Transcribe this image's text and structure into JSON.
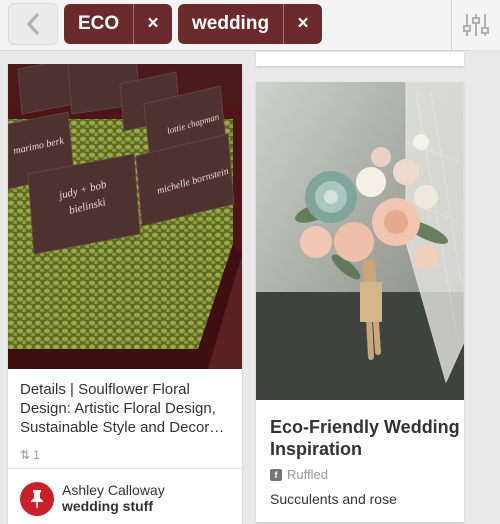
{
  "search": {
    "tokens": [
      {
        "label": "ECO",
        "remove": "×"
      },
      {
        "label": "wedding",
        "remove": "×"
      }
    ]
  },
  "pins": [
    {
      "description": "Details | Soulflower Floral Design: Artistic Floral Design, Sustainable Style and Decor…",
      "repin_count": "1",
      "pinner": "Ashley Calloway",
      "board": "wedding stuff",
      "place_cards": [
        "marimo berk",
        "judy + bob bielinski",
        "michelle bornstein",
        "lottie chapman"
      ]
    },
    {
      "title": "Eco-Friendly Wedding Inspiration",
      "source": "Ruffled",
      "caption": "Succulents and rose"
    }
  ],
  "colors": {
    "accent": "#6b2a2c",
    "pinterest_red": "#cb2027"
  }
}
